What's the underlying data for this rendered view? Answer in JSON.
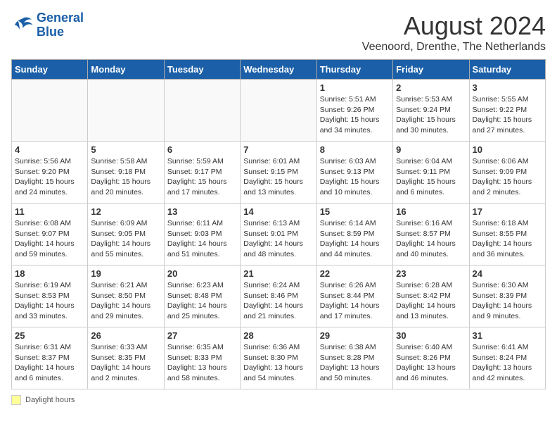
{
  "header": {
    "logo_line1": "General",
    "logo_line2": "Blue",
    "month_title": "August 2024",
    "subtitle": "Veenoord, Drenthe, The Netherlands"
  },
  "days_of_week": [
    "Sunday",
    "Monday",
    "Tuesday",
    "Wednesday",
    "Thursday",
    "Friday",
    "Saturday"
  ],
  "weeks": [
    [
      {
        "day": "",
        "info": ""
      },
      {
        "day": "",
        "info": ""
      },
      {
        "day": "",
        "info": ""
      },
      {
        "day": "",
        "info": ""
      },
      {
        "day": "1",
        "info": "Sunrise: 5:51 AM\nSunset: 9:26 PM\nDaylight: 15 hours\nand 34 minutes."
      },
      {
        "day": "2",
        "info": "Sunrise: 5:53 AM\nSunset: 9:24 PM\nDaylight: 15 hours\nand 30 minutes."
      },
      {
        "day": "3",
        "info": "Sunrise: 5:55 AM\nSunset: 9:22 PM\nDaylight: 15 hours\nand 27 minutes."
      }
    ],
    [
      {
        "day": "4",
        "info": "Sunrise: 5:56 AM\nSunset: 9:20 PM\nDaylight: 15 hours\nand 24 minutes."
      },
      {
        "day": "5",
        "info": "Sunrise: 5:58 AM\nSunset: 9:18 PM\nDaylight: 15 hours\nand 20 minutes."
      },
      {
        "day": "6",
        "info": "Sunrise: 5:59 AM\nSunset: 9:17 PM\nDaylight: 15 hours\nand 17 minutes."
      },
      {
        "day": "7",
        "info": "Sunrise: 6:01 AM\nSunset: 9:15 PM\nDaylight: 15 hours\nand 13 minutes."
      },
      {
        "day": "8",
        "info": "Sunrise: 6:03 AM\nSunset: 9:13 PM\nDaylight: 15 hours\nand 10 minutes."
      },
      {
        "day": "9",
        "info": "Sunrise: 6:04 AM\nSunset: 9:11 PM\nDaylight: 15 hours\nand 6 minutes."
      },
      {
        "day": "10",
        "info": "Sunrise: 6:06 AM\nSunset: 9:09 PM\nDaylight: 15 hours\nand 2 minutes."
      }
    ],
    [
      {
        "day": "11",
        "info": "Sunrise: 6:08 AM\nSunset: 9:07 PM\nDaylight: 14 hours\nand 59 minutes."
      },
      {
        "day": "12",
        "info": "Sunrise: 6:09 AM\nSunset: 9:05 PM\nDaylight: 14 hours\nand 55 minutes."
      },
      {
        "day": "13",
        "info": "Sunrise: 6:11 AM\nSunset: 9:03 PM\nDaylight: 14 hours\nand 51 minutes."
      },
      {
        "day": "14",
        "info": "Sunrise: 6:13 AM\nSunset: 9:01 PM\nDaylight: 14 hours\nand 48 minutes."
      },
      {
        "day": "15",
        "info": "Sunrise: 6:14 AM\nSunset: 8:59 PM\nDaylight: 14 hours\nand 44 minutes."
      },
      {
        "day": "16",
        "info": "Sunrise: 6:16 AM\nSunset: 8:57 PM\nDaylight: 14 hours\nand 40 minutes."
      },
      {
        "day": "17",
        "info": "Sunrise: 6:18 AM\nSunset: 8:55 PM\nDaylight: 14 hours\nand 36 minutes."
      }
    ],
    [
      {
        "day": "18",
        "info": "Sunrise: 6:19 AM\nSunset: 8:53 PM\nDaylight: 14 hours\nand 33 minutes."
      },
      {
        "day": "19",
        "info": "Sunrise: 6:21 AM\nSunset: 8:50 PM\nDaylight: 14 hours\nand 29 minutes."
      },
      {
        "day": "20",
        "info": "Sunrise: 6:23 AM\nSunset: 8:48 PM\nDaylight: 14 hours\nand 25 minutes."
      },
      {
        "day": "21",
        "info": "Sunrise: 6:24 AM\nSunset: 8:46 PM\nDaylight: 14 hours\nand 21 minutes."
      },
      {
        "day": "22",
        "info": "Sunrise: 6:26 AM\nSunset: 8:44 PM\nDaylight: 14 hours\nand 17 minutes."
      },
      {
        "day": "23",
        "info": "Sunrise: 6:28 AM\nSunset: 8:42 PM\nDaylight: 14 hours\nand 13 minutes."
      },
      {
        "day": "24",
        "info": "Sunrise: 6:30 AM\nSunset: 8:39 PM\nDaylight: 14 hours\nand 9 minutes."
      }
    ],
    [
      {
        "day": "25",
        "info": "Sunrise: 6:31 AM\nSunset: 8:37 PM\nDaylight: 14 hours\nand 6 minutes."
      },
      {
        "day": "26",
        "info": "Sunrise: 6:33 AM\nSunset: 8:35 PM\nDaylight: 14 hours\nand 2 minutes."
      },
      {
        "day": "27",
        "info": "Sunrise: 6:35 AM\nSunset: 8:33 PM\nDaylight: 13 hours\nand 58 minutes."
      },
      {
        "day": "28",
        "info": "Sunrise: 6:36 AM\nSunset: 8:30 PM\nDaylight: 13 hours\nand 54 minutes."
      },
      {
        "day": "29",
        "info": "Sunrise: 6:38 AM\nSunset: 8:28 PM\nDaylight: 13 hours\nand 50 minutes."
      },
      {
        "day": "30",
        "info": "Sunrise: 6:40 AM\nSunset: 8:26 PM\nDaylight: 13 hours\nand 46 minutes."
      },
      {
        "day": "31",
        "info": "Sunrise: 6:41 AM\nSunset: 8:24 PM\nDaylight: 13 hours\nand 42 minutes."
      }
    ]
  ],
  "footer": {
    "swatch_label": "Daylight hours"
  }
}
